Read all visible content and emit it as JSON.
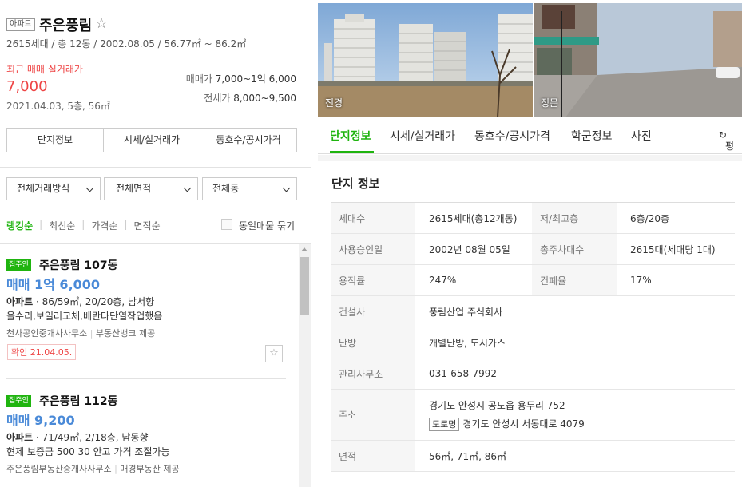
{
  "complex": {
    "type_badge": "아파트",
    "name": "주은풍림",
    "summary": "2615세대 / 총 12동 / 2002.08.05 / 56.77㎡ ~ 86.2㎡",
    "recent_label": "최근 매매 실거래가",
    "recent_price": "7,000",
    "recent_meta": "2021.04.03, 5층, 56㎡",
    "sale_label": "매매가",
    "sale_range": "7,000~1억 6,000",
    "rent_label": "전세가",
    "rent_range": "8,000~9,500"
  },
  "left_tabs": [
    "단지정보",
    "시세/실거래가",
    "동호수/공시가격"
  ],
  "filters": [
    "전체거래방식",
    "전체면적",
    "전체동"
  ],
  "sort": {
    "options": [
      "랭킹순",
      "최신순",
      "가격순",
      "면적순"
    ],
    "group_label": "동일매물 묶기"
  },
  "listings": [
    {
      "tag": "집주인",
      "title": "주은풍림 107동",
      "price": "매매 1억 6,000",
      "type": "아파트",
      "spec": " · 86/59㎡, 20/20층, 남서향",
      "desc": "올수리,보일러교체,베란다단열작업했음",
      "agency": "천사공인중개사사무소",
      "provider": "부동산뱅크 제공",
      "confirm": "확인 21.04.05."
    },
    {
      "tag": "집주인",
      "title": "주은풍림 112동",
      "price": "매매 9,200",
      "type": "아파트",
      "spec": " · 71/49㎡, 2/18층, 남동향",
      "desc": "현제 보증금 500 30 안고 가격 조절가능",
      "agency": "주은풍림부동산중개사사무소",
      "provider": "매경부동산 제공",
      "confirm": ""
    }
  ],
  "photos": {
    "panorama_caption": "전경",
    "gate_caption": "정문"
  },
  "nav_tabs": [
    "단지정보",
    "시세/실거래가",
    "동호수/공시가격",
    "학군정보",
    "사진"
  ],
  "nav_tail": "평",
  "section_title": "단지 정보",
  "info": {
    "households_label": "세대수",
    "households": "2615세대(총12개동)",
    "floors_label": "저/최고층",
    "floors": "6층/20층",
    "approval_label": "사용승인일",
    "approval": "2002년 08월 05일",
    "parking_label": "총주차대수",
    "parking": "2615대(세대당 1대)",
    "far_label": "용적률",
    "far": "247%",
    "bcr_label": "건폐율",
    "bcr": "17%",
    "builder_label": "건설사",
    "builder": "풍림산업 주식회사",
    "heating_label": "난방",
    "heating": "개별난방, 도시가스",
    "office_label": "관리사무소",
    "office": "031-658-7992",
    "address_label": "주소",
    "address": "경기도 안성시 공도읍 용두리 752",
    "road_tag": "도로명",
    "road_address": "경기도 안성시 서동대로 4079",
    "area_label": "면적",
    "area": "56㎡, 71㎡, 86㎡"
  }
}
